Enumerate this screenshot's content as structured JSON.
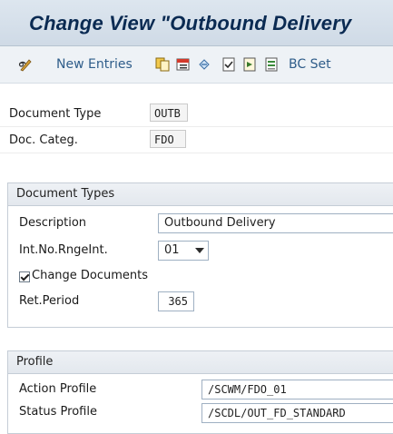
{
  "title": "Change View \"Outbound Delivery",
  "toolbar": {
    "new_entries_label": "New Entries",
    "bc_set_label": "BC Set"
  },
  "header_fields": {
    "document_type_label": "Document Type",
    "document_type_value": "OUTB",
    "doc_categ_label": "Doc. Categ.",
    "doc_categ_value": "FDO"
  },
  "document_types": {
    "header": "Document Types",
    "description_label": "Description",
    "description_value": "Outbound Delivery",
    "int_no_label": "Int.No.RngeInt.",
    "int_no_value": "01",
    "change_documents_label": "Change Documents",
    "change_documents_checked": true,
    "ret_period_label": "Ret.Period",
    "ret_period_value": "365"
  },
  "profile": {
    "header": "Profile",
    "action_profile_label": "Action Profile",
    "action_profile_value": "/SCWM/FDO_01",
    "status_profile_label": "Status Profile",
    "status_profile_value": "/SCDL/OUT_FD_STANDARD"
  }
}
